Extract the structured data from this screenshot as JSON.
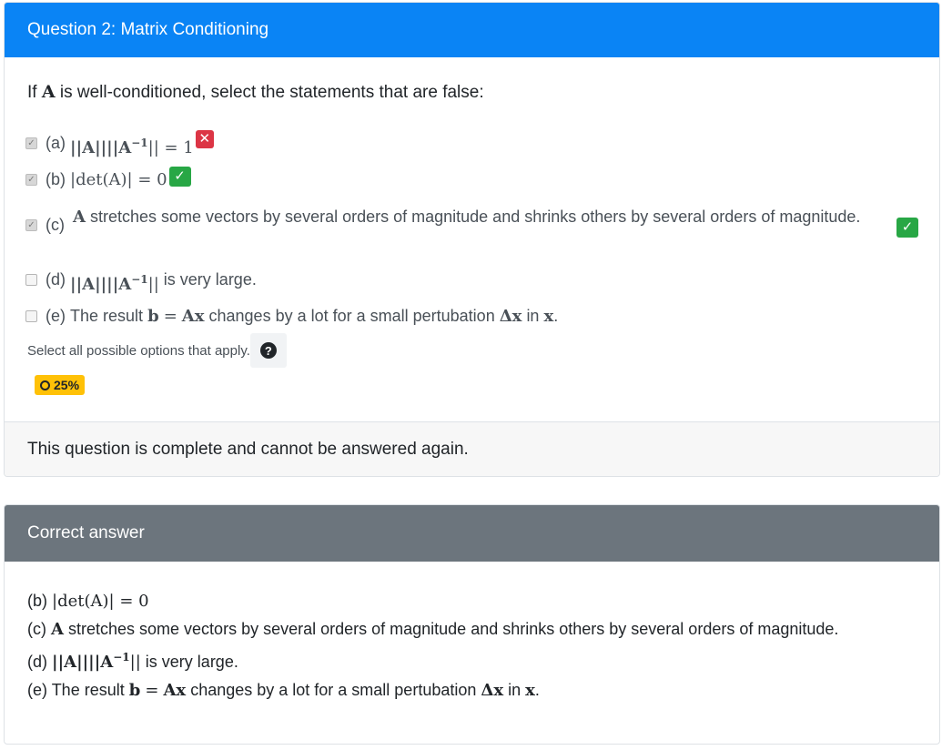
{
  "question": {
    "header": "Question 2: Matrix Conditioning",
    "prompt_pre": "If",
    "prompt_A": "A",
    "prompt_post": "is well-conditioned, select the statements that are false:",
    "options": [
      {
        "label": "(a)",
        "math": "||A||||A",
        "sup": "−1",
        "math_tail": "|| = 1",
        "checked": true,
        "status": "incorrect"
      },
      {
        "label": "(b)",
        "math": "|det(A)| = 0",
        "checked": true,
        "status": "correct"
      },
      {
        "label": "(c)",
        "math_A": "A",
        "text": "stretches some vectors by several orders of magnitude and shrinks others by several orders of magnitude.",
        "checked": true,
        "status": "correct"
      },
      {
        "label": "(d)",
        "math": "||A||||A",
        "sup": "−1",
        "math_tail": "||",
        "text": "is very large.",
        "checked": false
      },
      {
        "label": "(e)",
        "text1": "The result",
        "b": "b",
        "eq": "=",
        "Ax": "Ax",
        "text2": "changes by a lot for a small pertubation",
        "dx": "Δx",
        "text3": "in",
        "x": "x",
        "text4": ".",
        "checked": false
      }
    ],
    "hint": "Select all possible options that apply.",
    "help_icon": "question-circle-icon",
    "score": "25%",
    "footer": "This question is complete and cannot be answered again."
  },
  "answer": {
    "header": "Correct answer",
    "items": [
      {
        "label": "(b)",
        "math": "|det(A)| = 0"
      },
      {
        "label": "(c)",
        "math_A": "A",
        "text": "stretches some vectors by several orders of magnitude and shrinks others by several orders of magnitude."
      },
      {
        "label": "(d)",
        "math": "||A||||A",
        "sup": "−1",
        "math_tail": "||",
        "text": "is very large."
      },
      {
        "label": "(e)",
        "text1": "The result",
        "b": "b",
        "eq": "=",
        "Ax": "Ax",
        "text2": "changes by a lot for a small pertubation",
        "dx": "Δx",
        "text3": "in",
        "x": "x",
        "text4": "."
      }
    ]
  },
  "colors": {
    "primary": "#0a84f5",
    "secondary": "#6c757d",
    "success": "#28a745",
    "danger": "#dc3545",
    "warning": "#ffc107"
  }
}
